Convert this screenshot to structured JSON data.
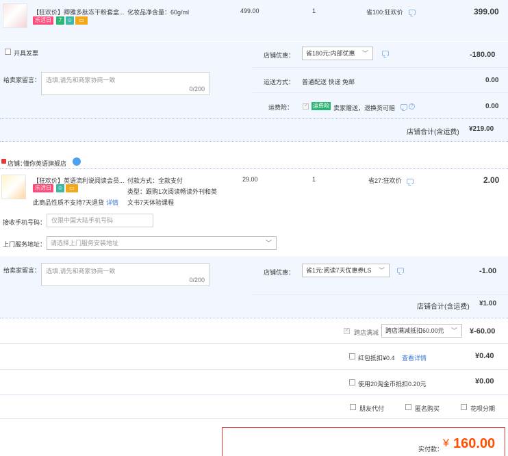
{
  "order1": {
    "title": "【狂欢价】卿雅多肽冻干粉套盒...",
    "tag": "乐活日",
    "spec": "化妆品净含量：60g/ml",
    "price": "499.00",
    "qty": "1",
    "saving": "省100:狂欢价",
    "subtotal": "399.00",
    "invoice_label": "开具发票",
    "shop_discount_label": "店铺优惠：",
    "shop_discount_value": "省180元:内部优惠",
    "shop_discount_amount": "-180.00",
    "message_label": "给卖家留言：",
    "message_placeholder": "选填,请先和商家协商一致",
    "message_count": "0/200",
    "shipping_label": "运送方式：",
    "shipping_value": "普通配送 快递 免邮",
    "shipping_amount": "0.00",
    "insurance_label": "运费险：",
    "insurance_tag": "运费险",
    "insurance_text": "卖家赠送，退换货可赔",
    "insurance_amount": "0.00",
    "total_label": "店铺合计(含运费)",
    "total_value": "¥219.00"
  },
  "shop2": {
    "label": "店铺：",
    "name": "懂你英语旗舰店"
  },
  "order2": {
    "title": "【狂欢价】英语流利说阅读会员...",
    "tag": "乐活日",
    "no_return": "此商品性质不支持7天退货",
    "detail_link": "详情",
    "spec1": "付款方式：全款支付",
    "spec2": "类型：跟购1次阅读畅读外刊和英",
    "spec3": "文书7天体验课程",
    "price": "29.00",
    "qty": "1",
    "saving": "省27:狂欢价",
    "subtotal": "2.00",
    "phone_label": "接收手机号码：",
    "phone_placeholder": "仅限中国大陆手机号码",
    "address_label": "上门服务地址：",
    "address_placeholder": "请选择上门服务安装地址",
    "message_label": "给卖家留言：",
    "message_placeholder": "选填,请先和商家协商一致",
    "message_count": "0/200",
    "shop_discount_label": "店铺优惠：",
    "shop_discount_value": "省1元:阅读7天优惠券LS",
    "shop_discount_amount": "-1.00",
    "total_label": "店铺合计(含运费)",
    "total_value": "¥1.00"
  },
  "summary": {
    "cross_label": "跨店满减",
    "cross_value": "跨店满减抵扣60.00元",
    "cross_amount": "¥-60.00",
    "redpacket_label": "红包抵扣¥0.4",
    "redpacket_link": "查看详情",
    "redpacket_amount": "¥0.40",
    "coin_label": "使用20淘金币抵扣0.20元",
    "coin_amount": "¥0.00",
    "friend_pay": "朋友代付",
    "anonymous": "匿名购买",
    "huabei": "花呗分期",
    "pay_label": "实付款：",
    "pay_currency": "¥",
    "pay_value": "160.00"
  },
  "colors": {
    "accent_red": "#e4393c",
    "accent_orange": "#ff5000",
    "row_blue": "#f2f7ff"
  }
}
